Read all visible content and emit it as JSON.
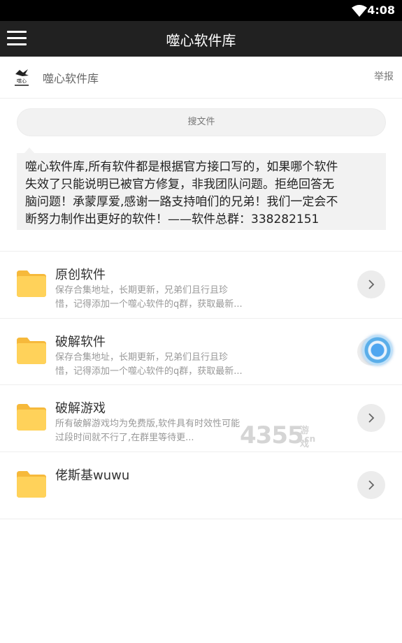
{
  "status_bar": {
    "time": "4:08",
    "wifi_icon": "wifi-icon"
  },
  "app_bar": {
    "title": "噬心软件库",
    "menu_icon": "hamburger-menu-icon"
  },
  "site": {
    "name": "噬心软件库",
    "report_label": "举报",
    "logo_icon": "site-logo"
  },
  "search": {
    "placeholder": "搜文件"
  },
  "notice": {
    "lines": [
      "噬心软件库,所有软件都是根据官方接口写的，如果哪个软件",
      "失效了只能说明已被官方修复，非我团队问题。拒绝回答无",
      "脑问题！承蒙厚爱,感谢一路支持咱们的兄弟！我们一定会不",
      "断努力制作出更好的软件！——软件总群：338282151"
    ]
  },
  "items": [
    {
      "name": "原创软件",
      "desc_lines": [
        "保存合集地址，长期更新，兄弟们且行且珍",
        "惜，记得添加一个噬心软件的q群，获取最新..."
      ],
      "icon": "folder-icon"
    },
    {
      "name": "破解软件",
      "desc_lines": [
        "保存合集地址，长期更新，兄弟们且行且珍",
        "惜，记得添加一个噬心软件的q群，获取最新..."
      ],
      "icon": "folder-icon"
    },
    {
      "name": "破解游戏",
      "desc_lines": [
        "所有破解游戏均为免费版,软件具有时效性可能",
        "过段时间就不行了,在群里等待更..."
      ],
      "icon": "folder-icon"
    },
    {
      "name": "佬斯基wuwu",
      "desc_lines": [
        "",
        ""
      ],
      "icon": "folder-icon"
    }
  ],
  "watermark": {
    "number": "4355",
    "text": "游戏",
    "domain": ".cn"
  },
  "colors": {
    "app_bar": "#212121",
    "folder": "#FFD25A",
    "background": "#FFFFFF"
  }
}
